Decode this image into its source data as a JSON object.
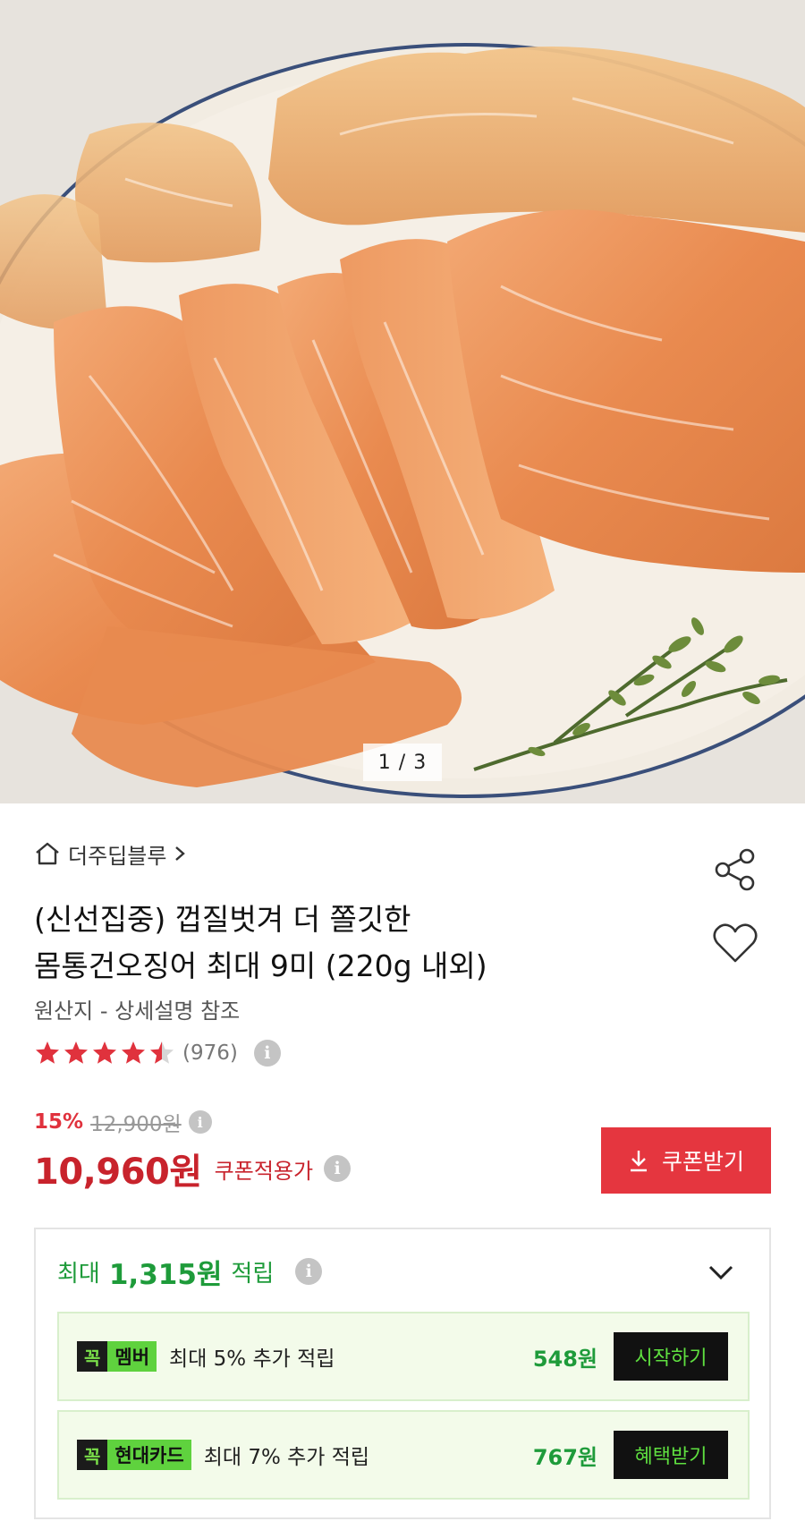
{
  "gallery": {
    "pager": "1 / 3"
  },
  "product": {
    "brand": "더주딥블루",
    "title_line1": "(신선집중) 껍질벗겨 더 쫄깃한",
    "title_line2": "몸통건오징어 최대 9미 (220g 내외)",
    "origin": "원산지 - 상세설명 참조",
    "rating": 4.5,
    "review_count": "(976)"
  },
  "price": {
    "discount": "15%",
    "original": "12,900원",
    "final": "10,960원",
    "coupon_label": "쿠폰적용가",
    "coupon_button": "쿠폰받기"
  },
  "rewards": {
    "head_prefix": "최대",
    "head_amount": "1,315원",
    "head_suffix": "적립",
    "rows": [
      {
        "tag_prefix": "꼭",
        "tag_name": "멤버",
        "desc": "최대 5% 추가 적립",
        "amount": "548원",
        "button": "시작하기"
      },
      {
        "tag_prefix": "꼭",
        "tag_name": "현대카드",
        "desc": "최대 7% 추가 적립",
        "amount": "767원",
        "button": "혜택받기"
      }
    ]
  },
  "colors": {
    "accent_red": "#e5363f",
    "price_red": "#c8232c",
    "reward_green": "#1e9b3a",
    "tag_green": "#5fd23e"
  }
}
